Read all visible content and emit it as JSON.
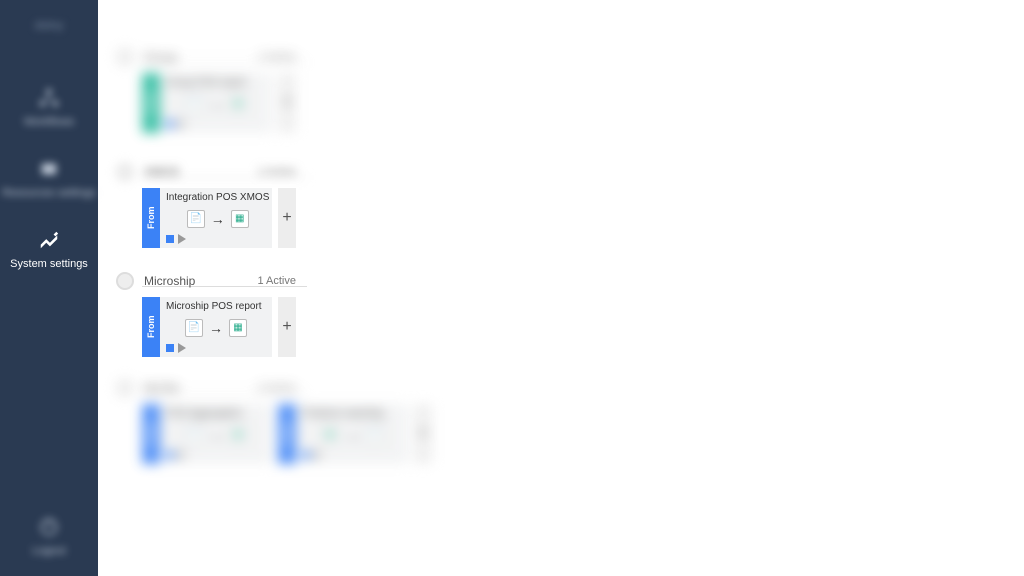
{
  "sidebar": {
    "logo": "dstny",
    "items": [
      {
        "icon": "workflow-icon",
        "label": "Workflows"
      },
      {
        "icon": "resources-icon",
        "label": "Resources settings"
      },
      {
        "icon": "settings-icon",
        "label": "System settings"
      },
      {
        "icon": "logout-icon",
        "label": "Logout"
      }
    ]
  },
  "sections": [
    {
      "name": "Group",
      "count": "1 Active",
      "cards": [
        {
          "title": "Group POS report",
          "side": "teal",
          "side_label": "From"
        }
      ]
    },
    {
      "name": "XMOS",
      "count": "1 Active",
      "cards": [
        {
          "title": "Integration POS XMOS",
          "side": "blue",
          "side_label": "From"
        }
      ]
    },
    {
      "name": "Microship",
      "count": "1 Active",
      "cards": [
        {
          "title": "Microship POS report",
          "side": "blue",
          "side_label": "From"
        }
      ]
    },
    {
      "name": "MuTek",
      "count": "2 Active",
      "cards": [
        {
          "title": "POS Aggregation",
          "side": "blue",
          "side_label": "From"
        },
        {
          "title": "Products reporting",
          "side": "blue",
          "side_label": "From"
        }
      ]
    }
  ],
  "add_label": "+"
}
